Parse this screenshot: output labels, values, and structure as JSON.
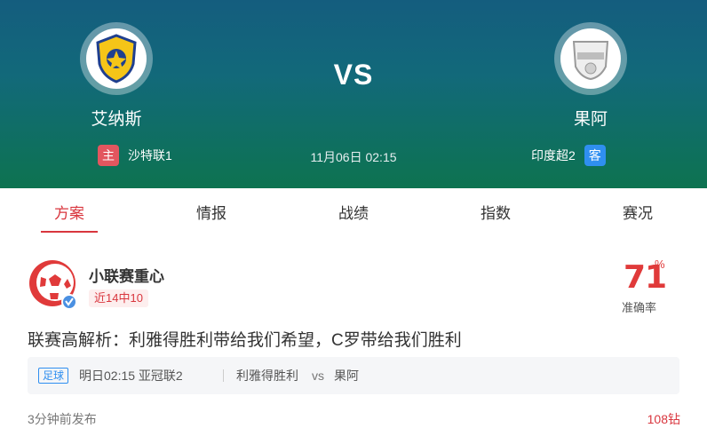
{
  "match": {
    "home_team": "艾纳斯",
    "away_team": "果阿",
    "vs": "VS",
    "home_tag": "主",
    "away_tag": "客",
    "home_league": "沙特联1",
    "away_league": "印度超2",
    "datetime": "11月06日 02:15"
  },
  "tabs": [
    {
      "label": "方案",
      "active": true
    },
    {
      "label": "情报",
      "active": false
    },
    {
      "label": "战绩",
      "active": false
    },
    {
      "label": "指数",
      "active": false
    },
    {
      "label": "赛况",
      "active": false
    }
  ],
  "expert": {
    "name": "小联赛重心",
    "record": "近14中10",
    "accuracy_value": "71",
    "accuracy_unit": "%",
    "accuracy_label": "准确率"
  },
  "article": {
    "title": "联赛高解析：利雅得胜利带给我们希望，C罗带给我们胜利"
  },
  "match_card": {
    "sport": "足球",
    "time_league": "明日02:15  亚冠联2",
    "home": "利雅得胜利",
    "vs": "vs",
    "away": "果阿"
  },
  "footer": {
    "published": "3分钟前发布",
    "price": "108钻"
  },
  "colors": {
    "accent": "#d9363e",
    "home_tag": "#e2565f",
    "away_tag": "#2f8ff0",
    "header_top": "#145d7e",
    "header_bottom": "#0d7350"
  }
}
